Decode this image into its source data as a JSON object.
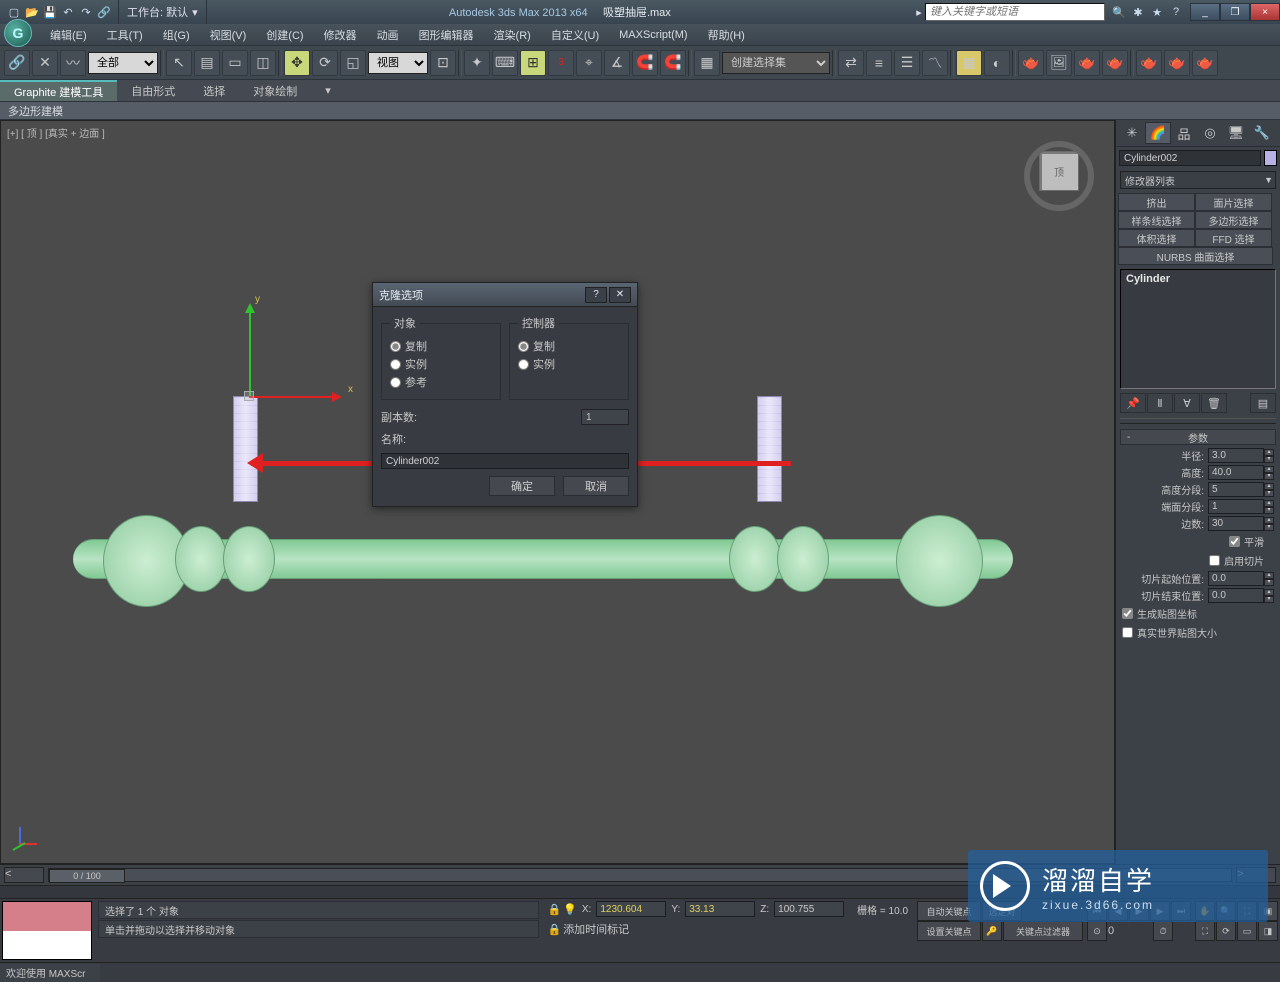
{
  "app": {
    "title_app": "Autodesk 3ds Max  2013 x64",
    "title_file": "吸塑抽屉.max",
    "workspace_label": "工作台: 默认",
    "search_placeholder": "键入关键字或短语",
    "win_min": "_",
    "win_max": "❐",
    "win_close": "×"
  },
  "menu": {
    "edit": "编辑(E)",
    "tools": "工具(T)",
    "group": "组(G)",
    "view": "视图(V)",
    "create": "创建(C)",
    "modifiers": "修改器",
    "animation": "动画",
    "graph": "图形编辑器",
    "rendering": "渲染(R)",
    "customize": "自定义(U)",
    "maxscript": "MAXScript(M)",
    "help": "帮助(H)"
  },
  "toolbar": {
    "filter_all": "全部",
    "view_combo": "视图",
    "named_set": "创建选择集"
  },
  "ribbon": {
    "t1": "Graphite 建模工具",
    "t2": "自由形式",
    "t3": "选择",
    "t4": "对象绘制",
    "sub": "多边形建模"
  },
  "viewport": {
    "label": "[+] [ 顶 ] [真实 + 边面 ]",
    "cube_face": "顶"
  },
  "dialog": {
    "title": "克隆选项",
    "grp_object": "对象",
    "opt_copy": "复制",
    "opt_instance": "实例",
    "opt_reference": "参考",
    "grp_controller": "控制器",
    "opt_ccopy": "复制",
    "opt_cinstance": "实例",
    "label_copies": "副本数:",
    "copies_value": "1",
    "label_name": "名称:",
    "name_value": "Cylinder002",
    "btn_ok": "确定",
    "btn_cancel": "取消"
  },
  "cmd": {
    "obj_name": "Cylinder002",
    "mod_list_label": "修改器列表",
    "mb1": "挤出",
    "mb2": "面片选择",
    "mb3": "样条线选择",
    "mb4": "多边形选择",
    "mb5": "体积选择",
    "mb6": "FFD 选择",
    "mb7": "NURBS 曲面选择",
    "stack_item": "Cylinder",
    "rollout_params": "参数",
    "p_radius": "半径:",
    "v_radius": "3.0",
    "p_height": "高度:",
    "v_height": "40.0",
    "p_hseg": "高度分段:",
    "v_hseg": "5",
    "p_cseg": "端面分段:",
    "v_cseg": "1",
    "p_sides": "边数:",
    "v_sides": "30",
    "chk_smooth": "平滑",
    "chk_slice": "启用切片",
    "p_slice_from": "切片起始位置:",
    "v_slice_from": "0.0",
    "p_slice_to": "切片结束位置:",
    "v_slice_to": "0.0",
    "chk_genuv": "生成贴图坐标",
    "chk_realworld": "真实世界贴图大小"
  },
  "timeline": {
    "frame_display": "0 / 100"
  },
  "status": {
    "prompt1": "选择了 1 个 对象",
    "prompt2": "单击并拖动以选择并移动对象",
    "marquee": "欢迎使用  MAXScr",
    "x_label": "X:",
    "x_val": "1230.604",
    "y_label": "Y:",
    "y_val": "33.13",
    "z_label": "Z:",
    "z_val": "100.755",
    "grid_label": "栅格 = 10.0",
    "autokey": "自动关键点",
    "setkey": "设置关键点",
    "selected": "选定对",
    "keyfilter": "关键点过滤器",
    "addtime": "添加时间标记"
  },
  "watermark": {
    "brand_big": "溜溜自学",
    "brand_small": "zixue.3d66.com"
  }
}
